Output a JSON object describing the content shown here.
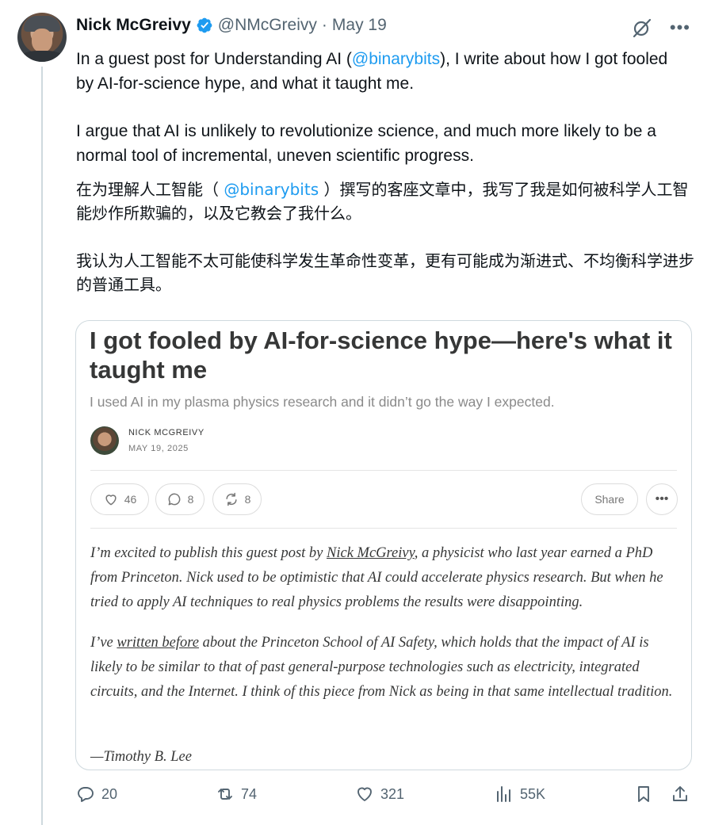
{
  "tweet": {
    "author_name": "Nick McGreivy",
    "handle": "@NMcGreivy",
    "separator": "·",
    "date": "May 19",
    "text": {
      "p1_before": "In a guest post for Understanding AI (",
      "p1_mention": "@binarybits",
      "p1_after": "), I write about how I got fooled by AI-for-science hype, and what it taught me.",
      "p2": "I argue that AI is unlikely to revolutionize science, and much more likely to be a normal tool of incremental, uneven scientific progress."
    },
    "translation": {
      "p1_before": "在为理解人工智能（ ",
      "p1_mention": "@binarybits",
      "p1_after": " ）撰写的客座文章中，我写了我是如何被科学人工智能炒作所欺骗的，以及它教会了我什么。",
      "p2": "我认为人工智能不太可能使科学发生革命性变革，更有可能成为渐进式、不均衡科学进步的普通工具。"
    }
  },
  "card": {
    "title": "I got fooled by AI-for-science hype—here's what it taught me",
    "subtitle": "I used AI in my plasma physics research and it didn’t go the way I expected.",
    "author": "NICK MCGREIVY",
    "date": "MAY 19, 2025",
    "likes": "46",
    "comments": "8",
    "restacks": "8",
    "share_label": "Share",
    "more_label": "•••",
    "para1_a": "I’m excited to publish this guest post by ",
    "para1_link": "Nick McGreivy",
    "para1_b": ", a physicist who last year earned a PhD from Princeton. Nick used to be optimistic that AI could accelerate physics research. But when he tried to apply AI techniques to real physics problems the results were disappointing.",
    "para2_a": "I’ve ",
    "para2_link": "written before",
    "para2_b": " about the Princeton School of AI Safety, which holds that the impact of AI is likely to be similar to that of past general-purpose technologies such as electricity, integrated circuits, and the Internet. I think of this piece from Nick as being in that same intellectual tradition.",
    "signoff": "—Timothy B. Lee"
  },
  "actions": {
    "replies": "20",
    "reposts": "74",
    "likes": "321",
    "views": "55K"
  },
  "icons": {
    "verified": "verified-badge-icon",
    "grok": "grok-icon",
    "more": "more-icon",
    "reply": "reply-icon",
    "repost": "repost-icon",
    "like": "heart-icon",
    "views": "views-icon",
    "bookmark": "bookmark-icon",
    "share": "share-icon"
  },
  "colors": {
    "accent": "#1d9bf0",
    "text": "#0f1419",
    "secondary": "#536471"
  }
}
